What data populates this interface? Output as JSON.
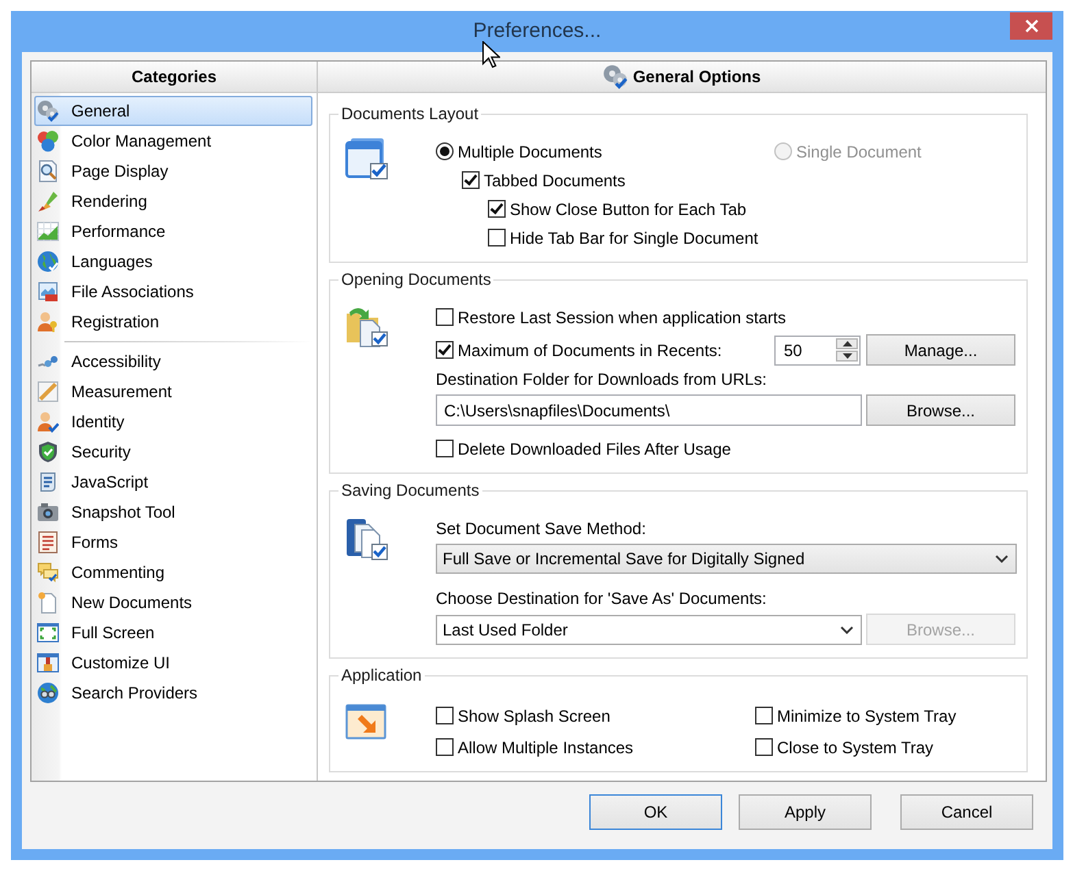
{
  "window": {
    "title": "Preferences..."
  },
  "categories": {
    "title": "Categories",
    "sections": [
      {
        "items": [
          {
            "label": "General",
            "selected": true
          },
          {
            "label": "Color Management",
            "selected": false
          },
          {
            "label": "Page Display",
            "selected": false
          },
          {
            "label": "Rendering",
            "selected": false
          },
          {
            "label": "Performance",
            "selected": false
          },
          {
            "label": "Languages",
            "selected": false
          },
          {
            "label": "File Associations",
            "selected": false
          },
          {
            "label": "Registration",
            "selected": false
          }
        ]
      },
      {
        "items": [
          {
            "label": "Accessibility",
            "selected": false
          },
          {
            "label": "Measurement",
            "selected": false
          },
          {
            "label": "Identity",
            "selected": false
          },
          {
            "label": "Security",
            "selected": false
          },
          {
            "label": "JavaScript",
            "selected": false
          },
          {
            "label": "Snapshot Tool",
            "selected": false
          },
          {
            "label": "Forms",
            "selected": false
          },
          {
            "label": "Commenting",
            "selected": false
          },
          {
            "label": "New Documents",
            "selected": false
          },
          {
            "label": "Full Screen",
            "selected": false
          },
          {
            "label": "Customize UI",
            "selected": false
          },
          {
            "label": "Search Providers",
            "selected": false
          }
        ]
      }
    ]
  },
  "options": {
    "title": "General Options",
    "documents_layout": {
      "title": "Documents Layout",
      "modes": [
        {
          "label": "Multiple Documents",
          "selected": true,
          "disabled": false
        },
        {
          "label": "Single Document",
          "selected": false,
          "disabled": true
        }
      ],
      "options": [
        {
          "label": "Tabbed Documents",
          "checked": true,
          "children": [
            {
              "label": "Show Close Button for Each Tab",
              "checked": true
            },
            {
              "label": "Hide Tab Bar for Single Document",
              "checked": false
            }
          ]
        }
      ]
    },
    "opening_documents": {
      "title": "Opening Documents",
      "restore_session": {
        "label": "Restore Last Session when application starts",
        "checked": false
      },
      "max_recents": {
        "label": "Maximum of Documents in Recents:",
        "checked": true,
        "value": "50",
        "button": "Manage..."
      },
      "download_folder": {
        "label": "Destination Folder for Downloads from URLs:",
        "value": "C:\\Users\\snapfiles\\Documents\\",
        "button": "Browse..."
      },
      "delete_downloads": {
        "label": "Delete Downloaded Files After Usage",
        "checked": false
      }
    },
    "saving_documents": {
      "title": "Saving Documents",
      "save_method": {
        "label": "Set Document Save Method:",
        "value": "Full Save or Incremental Save for Digitally Signed"
      },
      "save_as_destination": {
        "label": "Choose Destination for 'Save As' Documents:",
        "value": "Last Used Folder",
        "button": {
          "label": "Browse...",
          "disabled": true
        }
      }
    },
    "application": {
      "title": "Application",
      "options": [
        {
          "label": "Show Splash Screen",
          "checked": false
        },
        {
          "label": "Allow Multiple Instances",
          "checked": false
        },
        {
          "label": "Minimize to System Tray",
          "checked": false
        },
        {
          "label": "Close to System Tray",
          "checked": false
        }
      ]
    }
  },
  "buttons": [
    {
      "label": "OK",
      "default": true
    },
    {
      "label": "Apply",
      "default": false
    },
    {
      "label": "Cancel",
      "default": false
    }
  ]
}
